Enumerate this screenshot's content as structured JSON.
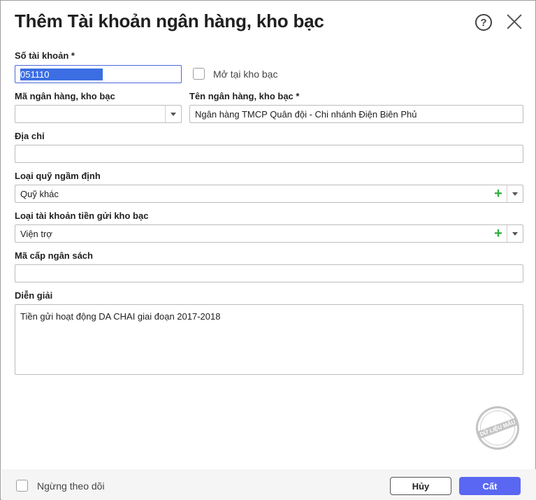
{
  "dialog": {
    "title": "Thêm Tài khoản ngân hàng, kho bạc"
  },
  "form": {
    "account_number": {
      "label": "Số tài khoản *",
      "value": "051110"
    },
    "treasury_checkbox": {
      "label": "Mở tại kho bạc",
      "checked": false
    },
    "bank_code": {
      "label": "Mã ngân hàng, kho bạc",
      "value": ""
    },
    "bank_name": {
      "label": "Tên ngân hàng, kho bạc *",
      "value": "Ngân hàng TMCP Quân đội - Chi nhánh Điện Biên Phủ"
    },
    "address": {
      "label": "Địa chỉ",
      "value": ""
    },
    "default_fund_type": {
      "label": "Loại quỹ ngầm định",
      "value": "Quỹ khác"
    },
    "treasury_deposit_type": {
      "label": "Loại tài khoản tiền gửi kho bạc",
      "value": "Viện trợ"
    },
    "budget_level_code": {
      "label": "Mã cấp ngân sách",
      "value": ""
    },
    "description": {
      "label": "Diễn giải",
      "value": "Tiền gửi hoạt động DA CHAI giai đoạn 2017-2018"
    }
  },
  "watermark": {
    "text": "DỮ LIỆU MẪU"
  },
  "footer": {
    "stop_tracking_label": "Ngừng theo dõi",
    "cancel_label": "Hủy",
    "save_label": "Cất"
  },
  "colors": {
    "primary": "#5a67f2",
    "focus": "#4a68d8",
    "add_green": "#2dab3e"
  },
  "icons": {
    "help": "help-icon",
    "close": "close-icon",
    "dropdown": "chevron-down-icon",
    "add": "plus-icon"
  }
}
